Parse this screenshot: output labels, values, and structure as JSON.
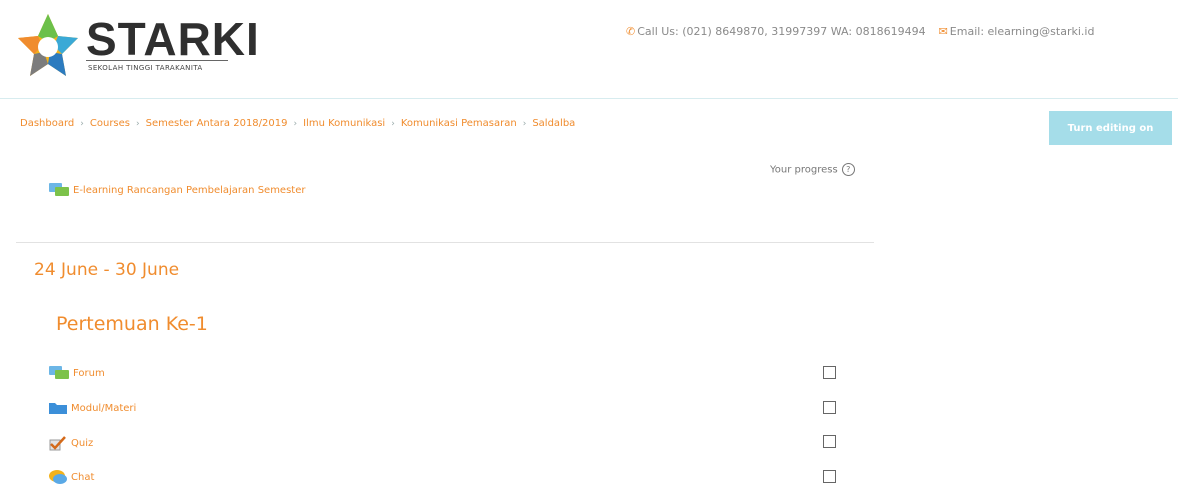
{
  "header": {
    "logo_text": "STARKI",
    "logo_subtitle": "SEKOLAH TINGGI TARAKANITA",
    "contact": {
      "call_label": "Call Us: (021) 8649870, 31997397 WA: 0818619494",
      "email_label": "Email: elearning@starki.id"
    }
  },
  "breadcrumb": [
    "Dashboard",
    "Courses",
    "Semester Antara 2018/2019",
    "Ilmu Komunikasi",
    "Komunikasi Pemasaran",
    "Saldalba"
  ],
  "edit_button": "Turn editing on",
  "progress_label": "Your progress",
  "top_activity": "E-learning Rancangan Pembelajaran Semester",
  "section": {
    "title": "24 June - 30 June",
    "subtitle": "Pertemuan Ke-1",
    "activities": [
      {
        "label": "Forum",
        "icon": "forum-icon"
      },
      {
        "label": "Modul/Materi",
        "icon": "folder-icon"
      },
      {
        "label": "Quiz",
        "icon": "quiz-icon"
      },
      {
        "label": "Chat",
        "icon": "chat-icon"
      }
    ]
  },
  "colors": {
    "accent": "#f08c2e",
    "button": "#a5dde9",
    "header_border": "#d7ecef"
  }
}
